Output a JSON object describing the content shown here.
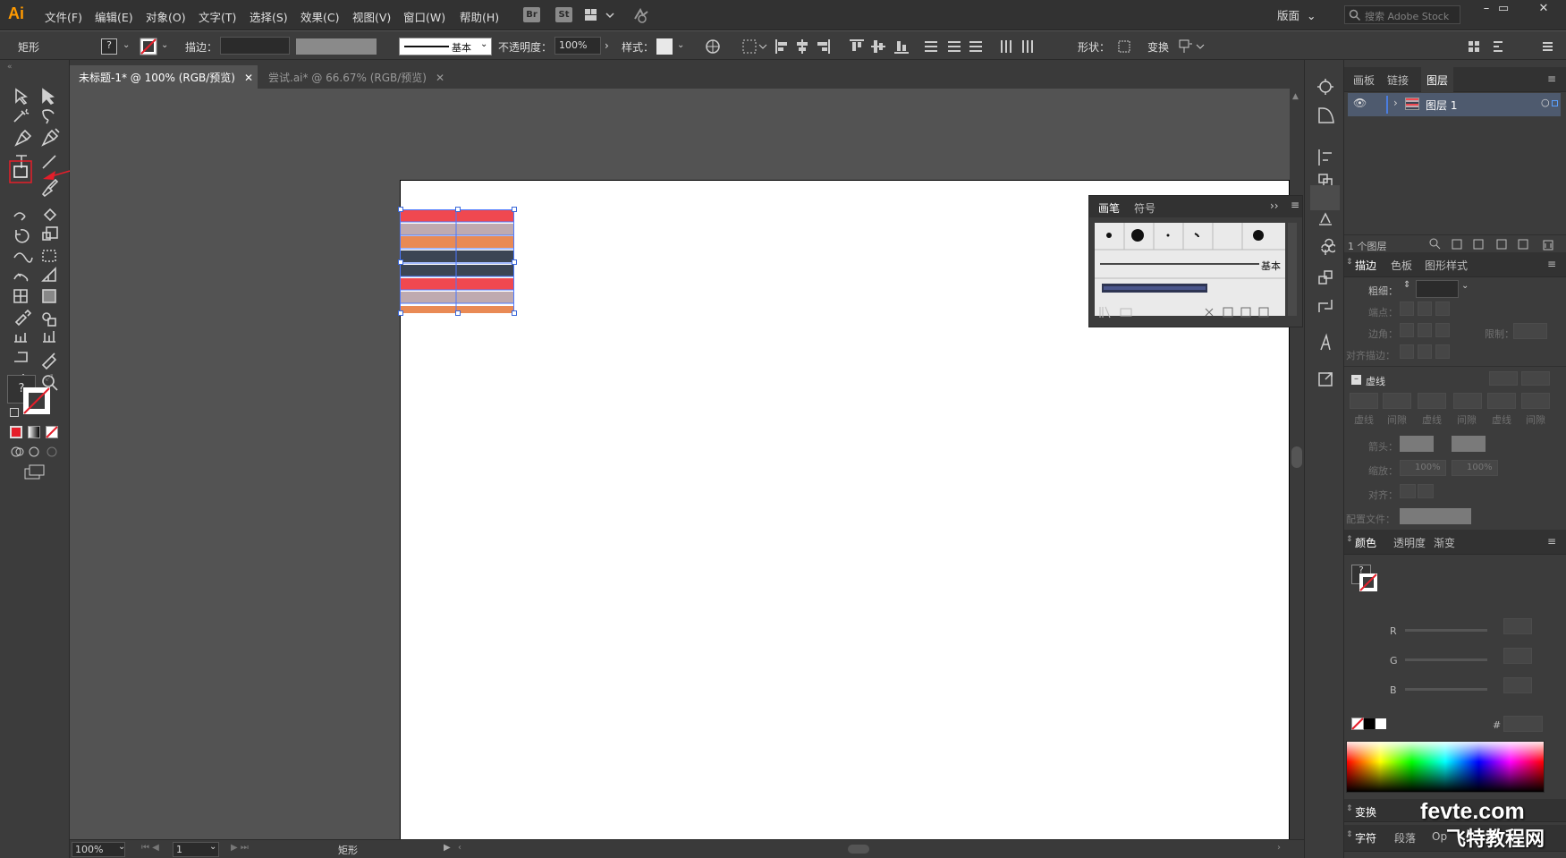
{
  "app": {
    "logo": "Ai"
  },
  "menu": [
    "文件(F)",
    "编辑(E)",
    "对象(O)",
    "文字(T)",
    "选择(S)",
    "效果(C)",
    "视图(V)",
    "窗口(W)",
    "帮助(H)"
  ],
  "menu_buttons": [
    "Br",
    "St"
  ],
  "workspace": "版面",
  "search_placeholder": "搜索 Adobe Stock",
  "control": {
    "object_type": "矩形",
    "stroke_label": "描边：",
    "brush_name": "基本",
    "opacity_label": "不透明度：",
    "opacity_value": "100%",
    "style_label": "样式：",
    "shape_label": "形状：",
    "transform_label": "变换"
  },
  "tabs": [
    {
      "label": "未标题-1* @ 100% (RGB/预览)",
      "active": true
    },
    {
      "label": "尝试.ai* @ 66.67% (RGB/预览)",
      "active": false
    }
  ],
  "status": {
    "zoom": "100%",
    "page": "1",
    "tool": "矩形"
  },
  "layers_panel": {
    "tabs": [
      "画板",
      "链接",
      "图层"
    ],
    "layer_name": "图层 1",
    "count": "1 个图层"
  },
  "stroke_panel": {
    "tabs": [
      "描边",
      "色板",
      "图形样式"
    ],
    "weight": "粗细：",
    "cap": "端点：",
    "corner": "边角：",
    "limit": "限制：",
    "align": "对齐描边：",
    "dashed": "虚线",
    "dash": "虚线",
    "gap": "间隙",
    "arrow": "箭头：",
    "scale": "缩放：",
    "scale_val": "100%",
    "align2": "对齐：",
    "profile": "配置文件："
  },
  "color_panel": {
    "tabs": [
      "颜色",
      "透明度",
      "渐变"
    ],
    "channels": [
      "R",
      "G",
      "B"
    ],
    "hex": "#"
  },
  "brush_panel": {
    "tabs": [
      "画笔",
      "符号"
    ],
    "basic": "基本"
  },
  "bottom_panels": [
    {
      "label": "变换"
    },
    {
      "label": "字符"
    },
    {
      "label": "段落"
    },
    {
      "label": "Op"
    }
  ],
  "watermark": {
    "line1": "fevte.com",
    "line2": "飞特教程网"
  },
  "colors": {
    "red": "#f04850",
    "mauve": "#bfaab0",
    "orange": "#e98a55",
    "navy": "#3c4554",
    "accent": "#e51e2a"
  }
}
